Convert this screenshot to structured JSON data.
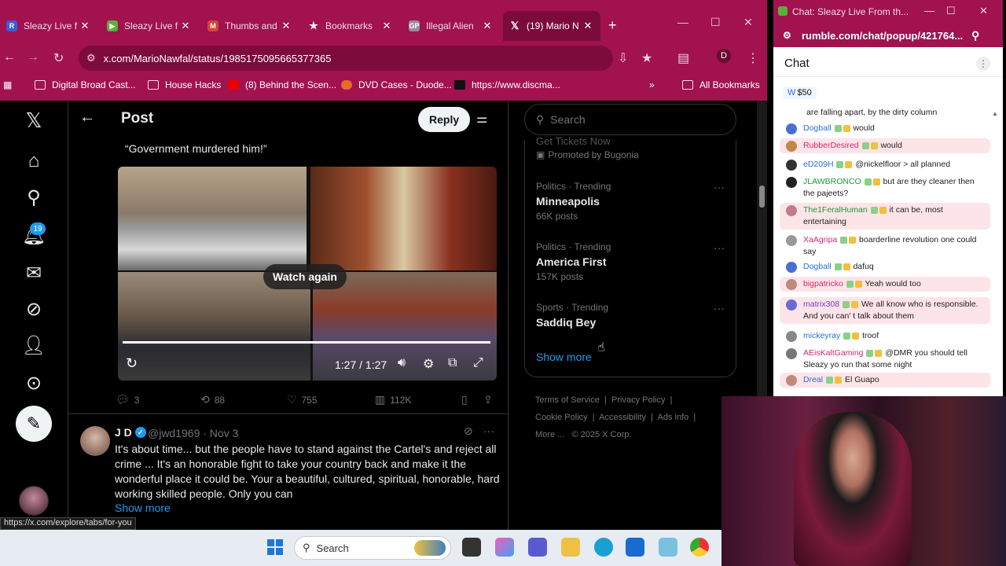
{
  "browser": {
    "tabs": [
      {
        "label": "Sleazy Live f",
        "icon": "rumble-icon"
      },
      {
        "label": "Sleazy Live f",
        "icon": "rumble-play-icon"
      },
      {
        "label": "Thumbs and",
        "icon": "gmail-icon"
      },
      {
        "label": "Bookmarks",
        "icon": "star-icon"
      },
      {
        "label": "Illegal Alien",
        "icon": "gp-icon"
      },
      {
        "label": "(19) Mario N",
        "icon": "x-icon"
      }
    ],
    "url": "x.com/MarioNawfal/status/1985175095665377365",
    "bookmarks": [
      "Digital Broad Cast...",
      "House Hacks",
      "(8) Behind the Scen...",
      "DVD Cases - Duode...",
      "https://www.discma...",
      "All Bookmarks"
    ],
    "profile_letter": "D"
  },
  "x": {
    "notif_count": "19",
    "header": {
      "title": "Post",
      "reply_label": "Reply"
    },
    "quote": "“Government murdered him!”",
    "video": {
      "watch_again": "Watch again",
      "time": "1:27 / 1:27",
      "progress": 1.0
    },
    "actions": {
      "replies": "3",
      "reposts": "88",
      "likes": "755",
      "views": "112K"
    },
    "reply": {
      "name": "J D",
      "handle": "@jwd1969 · Nov 3",
      "text": "It's about time... but the people have to stand against the Cartel's and reject all crime ... It's an honorable fight to take your country back and make it the wonderful place it could be. Your a beautiful, cultured, spiritual, honorable, hard working skilled people. Only you can",
      "show_more": "Show more"
    },
    "search_placeholder": "Search",
    "promo": {
      "line1": "Get Tickets Now",
      "line2": "Promoted by Bugonia"
    },
    "trends": [
      {
        "category": "Politics · Trending",
        "name": "Minneapolis",
        "posts": "66K posts"
      },
      {
        "category": "Politics · Trending",
        "name": "America First",
        "posts": "157K posts"
      },
      {
        "category": "Sports · Trending",
        "name": "Saddiq Bey",
        "posts": ""
      }
    ],
    "show_more": "Show more",
    "footer": {
      "terms": "Terms of Service",
      "privacy": "Privacy Policy",
      "cookie": "Cookie Policy",
      "accessibility": "Accessibility",
      "ads": "Ads info",
      "more": "More ...",
      "copyright": "© 2025 X Corp."
    },
    "status_url": "https://x.com/explore/tabs/for-you"
  },
  "taskbar": {
    "search_label": "Search"
  },
  "chat": {
    "window_title": "Chat: Sleazy Live From th...",
    "url": "rumble.com/chat/popup/421764...",
    "heading": "Chat",
    "rant": "$50",
    "first_line": "are falling apart, by the dirty column",
    "messages": [
      {
        "user": "Dogball",
        "text": "would",
        "user_color": "#2a6fdb",
        "avatar": "#4a6fd0",
        "highlight": false
      },
      {
        "user": "RubberDesired",
        "text": "would",
        "user_color": "#d02a6a",
        "avatar": "#c0884a",
        "highlight": true
      },
      {
        "user": "eD209H",
        "text": "@nickelfloor > all planned",
        "user_color": "#2a6fdb",
        "avatar": "#333333",
        "highlight": false
      },
      {
        "user": "JLAWBRONCO",
        "text": "but are they cleaner then the pajeets?",
        "user_color": "#1a9a3a",
        "avatar": "#222222",
        "highlight": false
      },
      {
        "user": "The1FeralHuman",
        "text": "it can be, most entertaining",
        "user_color": "#1a9a3a",
        "avatar": "#c07a8a",
        "highlight": true
      },
      {
        "user": "XaAgripa",
        "text": "boarderline revolution one could say",
        "user_color": "#d02a6a",
        "avatar": "#999999",
        "highlight": false
      },
      {
        "user": "Dogball",
        "text": "dafuq",
        "user_color": "#2a6fdb",
        "avatar": "#4a6fd0",
        "highlight": false
      },
      {
        "user": "bigpatricko",
        "text": "Yeah would too",
        "user_color": "#d02a6a",
        "avatar": "#c08a7a",
        "highlight": true
      },
      {
        "user": "matrix308",
        "text": "We all know who is responsible. And you can' t talk about them",
        "user_color": "#7a3ad0",
        "avatar": "#6a6ad0",
        "highlight": true
      },
      {
        "user": "mickeyray",
        "text": "troof",
        "user_color": "#2a6fdb",
        "avatar": "#888888",
        "highlight": false
      },
      {
        "user": "AEisKaltGaming",
        "text": "@DMR you should tell Sleazy yo run that some night",
        "user_color": "#d02a6a",
        "avatar": "#777777",
        "highlight": false
      },
      {
        "user": "Dreal",
        "text": "El Guapo",
        "user_color": "#2a6fdb",
        "avatar": "#c08a7a",
        "highlight": true
      }
    ]
  }
}
